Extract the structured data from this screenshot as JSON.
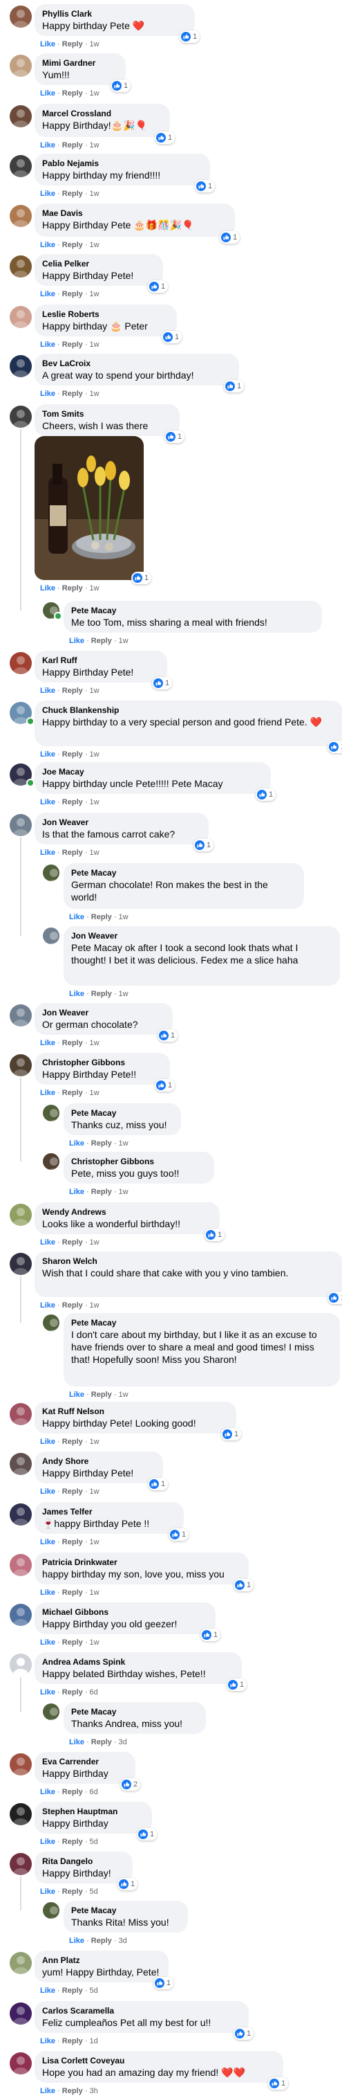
{
  "ui": {
    "like": "Like",
    "reply": "Reply",
    "dot": "·"
  },
  "comments": [
    {
      "name": "Phyllis Clark",
      "text": "Happy birthday Pete ❤️",
      "time": "1w",
      "react": "1"
    },
    {
      "name": "Mimi Gardner",
      "text": "Yum!!!",
      "time": "1w",
      "react": "1"
    },
    {
      "name": "Marcel Crossland",
      "text": "Happy Birthday!🎂🎉🎈",
      "time": "1w",
      "react": "1"
    },
    {
      "name": "Pablo Nejamis",
      "text": "Happy birthday my friend!!!!",
      "time": "1w",
      "react": "1"
    },
    {
      "name": "Mae Davis",
      "text": "Happy Birthday Pete 🎂🎁🎊🎉🎈",
      "time": "1w",
      "react": "1"
    },
    {
      "name": "Celia Pelker",
      "text": "Happy Birthday Pete!",
      "time": "1w",
      "react": "1"
    },
    {
      "name": "Leslie Roberts",
      "text": "Happy birthday 🎂 Peter",
      "time": "1w",
      "react": "1"
    },
    {
      "name": "Bev LaCroix",
      "text": "A great way to spend your birthday!",
      "time": "1w",
      "react": "1"
    },
    {
      "name": "Tom Smits",
      "text": "Cheers, wish I was there",
      "time": "1w",
      "react": "1"
    },
    {
      "name": "Pete Macay",
      "text": "Me too Tom, miss sharing a meal with friends!",
      "time": "1w"
    },
    {
      "name": "Karl Ruff",
      "text": "Happy Birthday Pete!",
      "time": "1w",
      "react": "1"
    },
    {
      "name": "Chuck Blankenship",
      "text": "Happy birthday to a very special person and good friend Pete. ❤️",
      "time": "1w",
      "react": "1"
    },
    {
      "name": "Joe Macay",
      "text": "Happy birthday uncle Pete!!!!! Pete Macay",
      "time": "1w",
      "react": "1"
    },
    {
      "name": "Jon Weaver",
      "text": "Is that the famous carrot cake?",
      "time": "1w",
      "react": "1"
    },
    {
      "name": "Pete Macay",
      "text": "German chocolate! Ron makes the best in the world!",
      "time": "1w"
    },
    {
      "name": "Jon Weaver",
      "text": "Pete Macay ok after I took a second look thats what I thought! I bet it was delicious. Fedex me a slice haha",
      "time": "1w"
    },
    {
      "name": "Jon Weaver",
      "text": "Or german chocolate?",
      "time": "1w",
      "react": "1"
    },
    {
      "name": "Christopher Gibbons",
      "text": "Happy Birthday Pete!!",
      "time": "1w",
      "react": "1"
    },
    {
      "name": "Pete Macay",
      "text": "Thanks cuz, miss you!",
      "time": "1w"
    },
    {
      "name": "Christopher Gibbons",
      "text": "Pete, miss you guys too!!",
      "time": "1w"
    },
    {
      "name": "Wendy Andrews",
      "text": "Looks like a wonderful birthday!!",
      "time": "1w",
      "react": "1"
    },
    {
      "name": "Sharon Welch",
      "text": "Wish that I could share that cake with you y vino tambien.",
      "time": "1w",
      "react": "1"
    },
    {
      "name": "Pete Macay",
      "text": "I don't care about my birthday, but I like it as an excuse to have friends over to share a meal and good times! I miss that! Hopefully soon! Miss you Sharon!",
      "time": "1w"
    },
    {
      "name": "Kat Ruff Nelson",
      "text": "Happy birthday Pete! Looking good!",
      "time": "1w",
      "react": "1"
    },
    {
      "name": "Andy Shore",
      "text": "Happy Birthday Pete!",
      "time": "1w",
      "react": "1"
    },
    {
      "name": "James Telfer",
      "text": "🍷happy Birthday Pete !!",
      "time": "1w",
      "react": "1"
    },
    {
      "name": "Patricia Drinkwater",
      "text": "happy birthday my son, love you, miss you",
      "time": "1w",
      "react": "1"
    },
    {
      "name": "Michael Gibbons",
      "text": "Happy Birthday you old geezer!",
      "time": "1w",
      "react": "1"
    },
    {
      "name": "Andrea Adams Spink",
      "text": "Happy belated Birthday wishes, Pete!!",
      "time": "6d",
      "react": "1"
    },
    {
      "name": "Pete Macay",
      "text": "Thanks Andrea, miss you!",
      "time": "3d"
    },
    {
      "name": "Eva Carrender",
      "text": "Happy Birthday",
      "time": "6d",
      "react": "2"
    },
    {
      "name": "Stephen Hauptman",
      "text": "Happy Birthday",
      "time": "5d",
      "react": "1"
    },
    {
      "name": "Rita Dangelo",
      "text": "Happy Birthday!",
      "time": "5d",
      "react": "1"
    },
    {
      "name": "Pete Macay",
      "text": "Thanks Rita! Miss you!",
      "time": "3d"
    },
    {
      "name": "Ann Platz",
      "text": "yum! Happy Birthday, Pete!",
      "time": "5d",
      "react": "1"
    },
    {
      "name": "Carlos Scaramella",
      "text": "Feliz cumpleaños Pet all my best for u!!",
      "time": "1d",
      "react": "1"
    },
    {
      "name": "Lisa Corlett Coveyau",
      "text": "Hope you had an amazing day my friend! ❤️❤️",
      "time": "3h",
      "react": "1"
    }
  ],
  "colors": {
    "like_blue": "#1877f2",
    "bubble": "#f0f2f5",
    "meta": "#65676b"
  }
}
